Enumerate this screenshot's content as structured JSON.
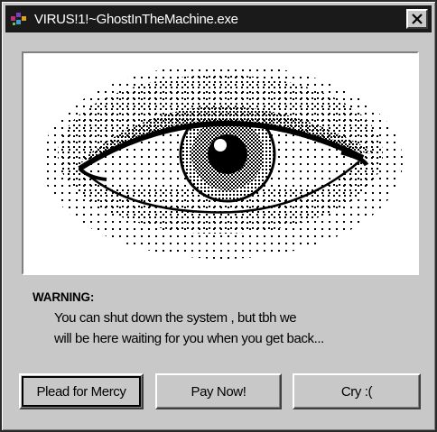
{
  "window": {
    "title": "VIRUS!1!~GhostInTheMachine.exe",
    "app_icon": "virus-app-icon",
    "close_icon": "close-icon"
  },
  "image": {
    "subject": "dithered-eye-icon"
  },
  "message": {
    "heading": "WARNING:",
    "line1": "You can shut down the system , but tbh we",
    "line2": "will be here waiting for you when you get back..."
  },
  "buttons": {
    "plead": "Plead for Mercy",
    "pay": "Pay Now!",
    "cry": "Cry :("
  },
  "colors": {
    "titlebar": "#1a1a1a",
    "window_bg": "#c8c8c8",
    "panel_bg": "#ffffff"
  }
}
